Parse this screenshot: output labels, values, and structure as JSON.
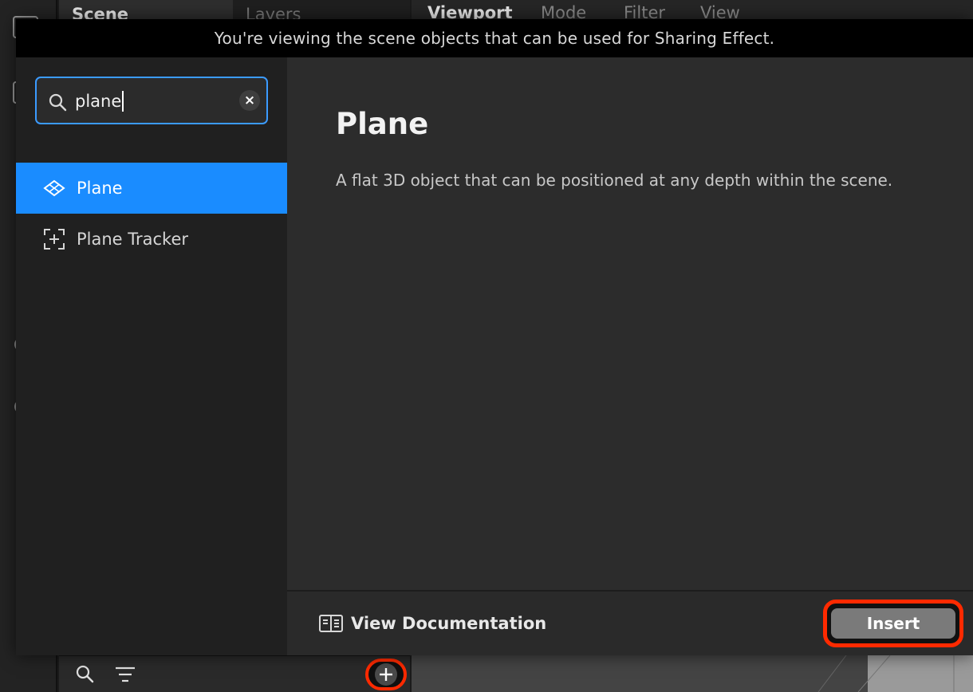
{
  "background": {
    "scene_panel": {
      "tabs": [
        "Scene",
        "Layers"
      ]
    },
    "viewport": {
      "tabs": [
        "Viewport",
        "Mode",
        "Filter",
        "View"
      ]
    },
    "bottom_bar": {
      "search_icon": "search-icon",
      "filter_icon": "filter-icon",
      "add_icon": "plus-icon"
    }
  },
  "dialog": {
    "banner": "You're viewing the scene objects that can be used for Sharing Effect.",
    "search": {
      "value": "plane",
      "clear_label": "×"
    },
    "results": [
      {
        "label": "Plane",
        "icon": "plane-icon",
        "selected": true
      },
      {
        "label": "Plane Tracker",
        "icon": "plane-tracker-icon",
        "selected": false
      }
    ],
    "detail": {
      "title": "Plane",
      "description": "A flat 3D object that can be positioned at any depth within the scene."
    },
    "footer": {
      "doc_label": "View Documentation",
      "insert_label": "Insert"
    },
    "colors": {
      "accent": "#1a8cff",
      "highlight": "#ff2a00",
      "banner_bg": "#000000"
    }
  }
}
